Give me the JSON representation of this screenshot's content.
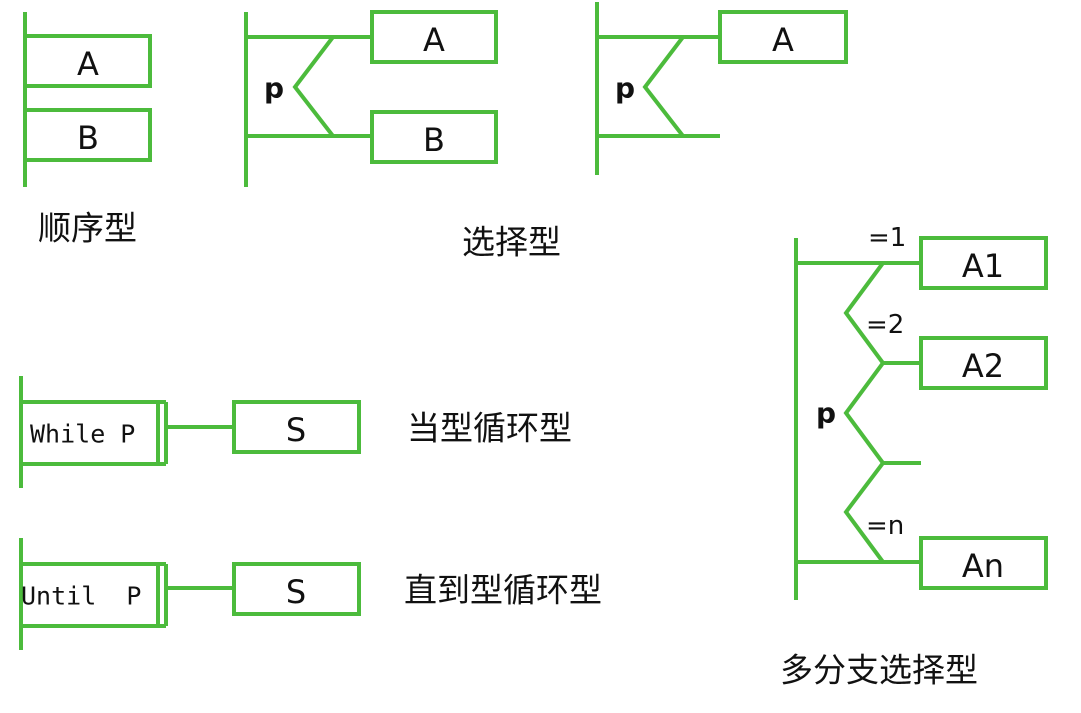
{
  "accent_color": "#4cbb3c",
  "sequence": {
    "box_a": "A",
    "box_b": "B",
    "caption": "顺序型"
  },
  "selection": {
    "condition": "p",
    "box_a": "A",
    "box_b": "B",
    "caption": "选择型"
  },
  "selection_single": {
    "condition": "p",
    "box_a": "A"
  },
  "while_loop": {
    "condition_label": "While P",
    "body": "S",
    "caption": "当型循环型"
  },
  "until_loop": {
    "condition_label": "Until  P",
    "body": "S",
    "caption": "直到型循环型"
  },
  "multi_branch": {
    "condition": "p",
    "branches": [
      {
        "label": "=1",
        "box": "A1"
      },
      {
        "label": "=2",
        "box": "A2"
      },
      {
        "label": "=n",
        "box": "An"
      }
    ],
    "caption": "多分支选择型"
  }
}
